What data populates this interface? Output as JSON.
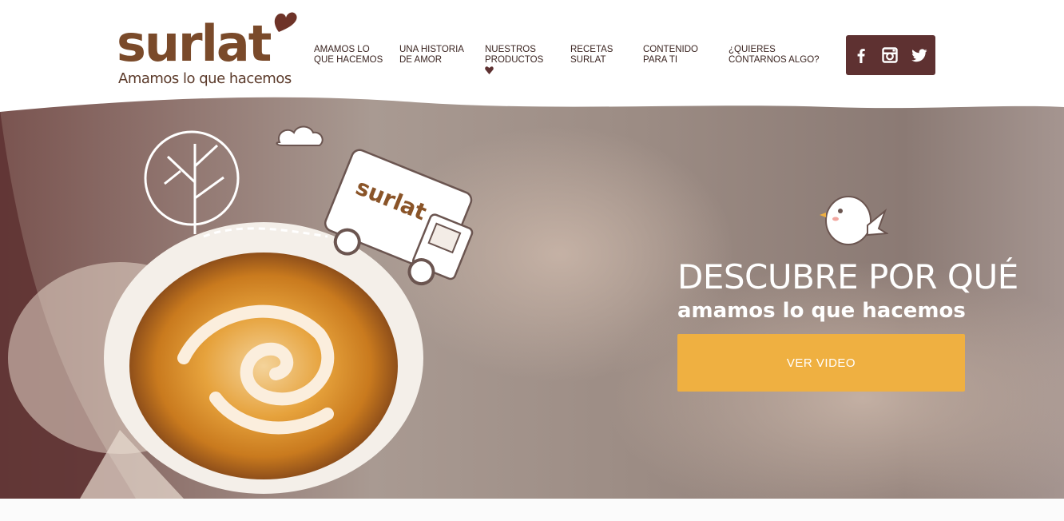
{
  "brand": {
    "name": "surlat",
    "tagline": "Amamos lo que hacemos",
    "primary_color": "#7a4a2a",
    "heart_color": "#6e3328"
  },
  "nav": {
    "items": [
      {
        "line1": "AMAMOS LO",
        "line2": "QUE HACEMOS"
      },
      {
        "line1": "UNA HISTORIA",
        "line2": "DE AMOR"
      },
      {
        "line1": "NUESTROS",
        "line2": "PRODUCTOS",
        "icon": "heart-dropdown-icon"
      },
      {
        "line1": "RECETAS",
        "line2": "SURLAT"
      },
      {
        "line1": "CONTENIDO",
        "line2": "PARA TI"
      },
      {
        "line1": "¿QUIERES",
        "line2": "CONTARNOS ALGO?"
      }
    ]
  },
  "social": {
    "background": "#5e3131",
    "icons": [
      "facebook-icon",
      "instagram-icon",
      "twitter-icon"
    ]
  },
  "hero": {
    "title": "DESCUBRE POR QUÉ",
    "subtitle": "amamos lo que hacemos",
    "cta_label": "VER VIDEO",
    "cta_color": "#efb041",
    "truck_brand": "surlat"
  }
}
